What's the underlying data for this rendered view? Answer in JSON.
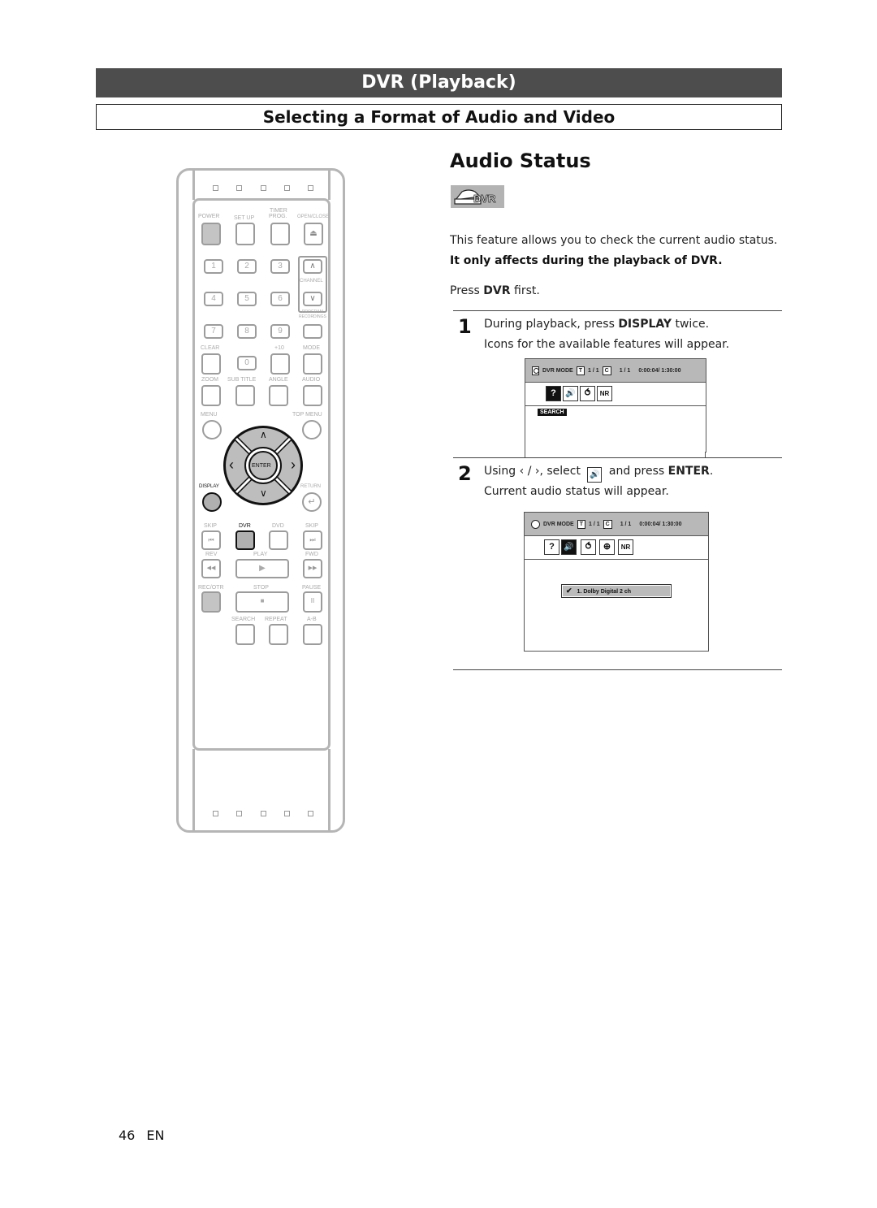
{
  "header": {
    "section_title": "DVR (Playback)",
    "subsection_title": "Selecting a Format of Audio and Video"
  },
  "content": {
    "heading": "Audio Status",
    "dvr_badge_label": "DVR",
    "intro": "This feature allows you to check the current audio status.",
    "note_bold": "It only affects during the playback of DVR.",
    "press_prefix": "Press ",
    "press_bold": "DVR",
    "press_suffix": " first.",
    "steps": [
      {
        "number": "1",
        "line1_prefix": "During playback, press ",
        "line1_bold": "DISPLAY",
        "line1_suffix": " twice.",
        "line2": "Icons for the available features will appear."
      },
      {
        "number": "2",
        "line1_prefix": "Using ",
        "line1_arrows": "‹ / ›",
        "line1_mid": ", select ",
        "line1_icon": "speaker-icon",
        "line1_and": " and press ",
        "line1_bold": "ENTER",
        "line1_suffix": ".",
        "line2": "Current audio status will appear."
      }
    ]
  },
  "osd": {
    "mode_label": "DVR MODE",
    "title_box": "T",
    "title_count": "1 / 1",
    "chapter_box": "C",
    "chapter_count": "1 / 1",
    "time": "0:00:04/ 1:30:00",
    "icons_screen1": [
      {
        "name": "search-icon",
        "glyph": "?",
        "selected": true
      },
      {
        "name": "audio-icon",
        "glyph": "🔊",
        "selected": false
      },
      {
        "name": "repeat-icon",
        "glyph": "⥀",
        "selected": false
      },
      {
        "name": "nr-icon",
        "glyph": "NR",
        "selected": false
      }
    ],
    "selected_label_screen1": "SEARCH",
    "icons_screen2": [
      {
        "name": "search-icon",
        "glyph": "?",
        "selected": false
      },
      {
        "name": "audio-icon",
        "glyph": "🔊",
        "selected": true
      },
      {
        "name": "repeat-icon",
        "glyph": "⥀",
        "selected": false
      },
      {
        "name": "zoom-icon",
        "glyph": "⊕",
        "selected": false
      },
      {
        "name": "nr-icon",
        "glyph": "NR",
        "selected": false
      }
    ],
    "audio_check": "✔",
    "audio_item": "1. Dolby Digital  2 ch"
  },
  "remote": {
    "labels": {
      "power": "POWER",
      "setup": "SET UP",
      "timer": "TIMER",
      "prog": "PROG.",
      "open_close": "OPEN/CLOSE",
      "channel": "CHANNEL",
      "program": "PROGRAM",
      "recordings": "RECORDINGS",
      "clear": "CLEAR",
      "plus10": "+10",
      "mode": "MODE",
      "zoom": "ZOOM",
      "subtitle": "SUB TITLE",
      "angle": "ANGLE",
      "audio": "AUDIO",
      "menu": "MENU",
      "top_menu": "TOP MENU",
      "enter": "ENTER",
      "display": "DISPLAY",
      "return": "RETURN",
      "skip_back": "SKIP",
      "dvr": "DVR",
      "dvd": "DVD",
      "skip_fwd": "SKIP",
      "rev": "REV",
      "play": "PLAY",
      "fwd": "FWD",
      "rec_otr": "REC/OTR",
      "stop": "STOP",
      "pause": "PAUSE",
      "search": "SEARCH",
      "repeat": "REPEAT",
      "ab": "A-B"
    },
    "digits": [
      "1",
      "2",
      "3",
      "4",
      "5",
      "6",
      "7",
      "8",
      "9",
      "0"
    ],
    "glyphs": {
      "eject": "⏏",
      "up": "∧",
      "down": "∨",
      "left": "‹",
      "right": "›",
      "skip_back": "⏮",
      "skip_fwd": "⏭",
      "rev": "◀◀",
      "fwd": "▶▶",
      "play": "▶",
      "stop": "■",
      "pause": "II",
      "return": "↵"
    }
  },
  "footer": {
    "page_number": "46",
    "language": "EN"
  }
}
